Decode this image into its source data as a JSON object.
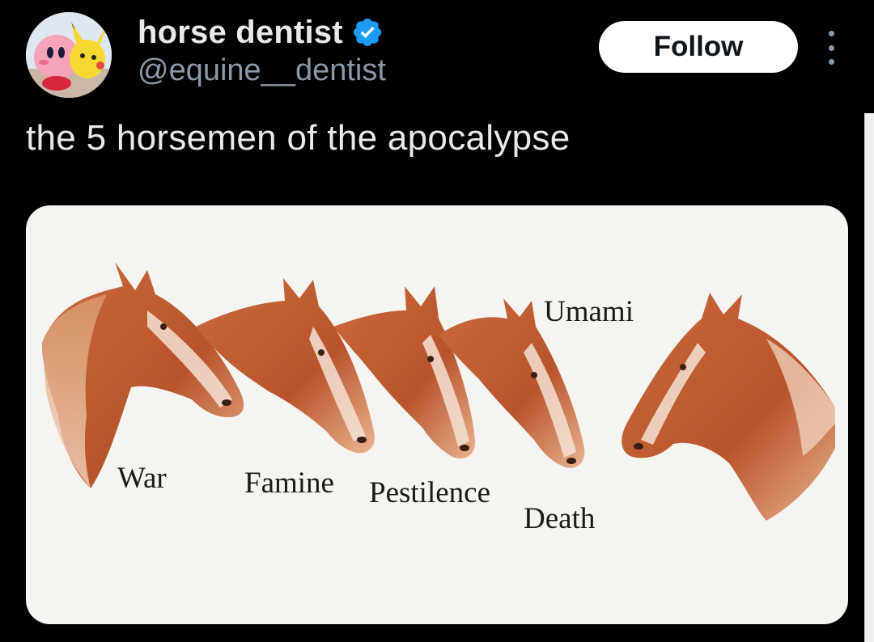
{
  "tweet": {
    "display_name": "horse dentist",
    "handle": "@equine__dentist",
    "verified_icon": "verified-badge-icon",
    "follow_label": "Follow",
    "more_icon": "more-options-icon",
    "text": "the 5 horsemen of the apocalypse"
  },
  "media": {
    "labels": {
      "war": "War",
      "famine": "Famine",
      "pestilence": "Pestilence",
      "death": "Death",
      "umami": "Umami"
    }
  },
  "colors": {
    "background": "#000000",
    "text_primary": "#e7e9ea",
    "text_secondary": "#8b98a5",
    "verified": "#1d9bf0",
    "follow_bg": "#ffffff"
  }
}
